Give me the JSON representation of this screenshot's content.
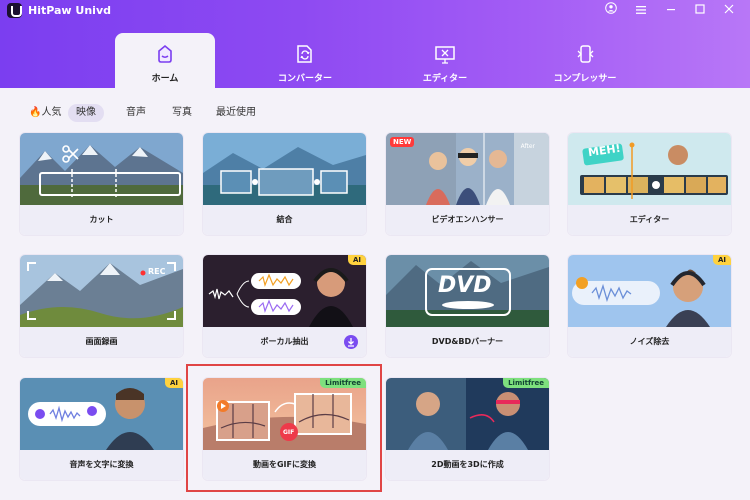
{
  "app": {
    "title": "HitPaw Univd"
  },
  "window_controls": [
    "user-icon",
    "menu-icon",
    "minimize-icon",
    "maximize-icon",
    "close-icon"
  ],
  "nav": {
    "tabs": [
      {
        "label": "ホーム",
        "icon": "home-icon",
        "active": true
      },
      {
        "label": "コンバーター",
        "icon": "converter-icon",
        "active": false
      },
      {
        "label": "エディター",
        "icon": "editor-icon",
        "active": false
      },
      {
        "label": "コンプレッサー",
        "icon": "compressor-icon",
        "active": false
      }
    ]
  },
  "categories": [
    {
      "label": "🔥人気",
      "active": false
    },
    {
      "label": "映像",
      "active": true
    },
    {
      "label": "音声",
      "active": false
    },
    {
      "label": "写真",
      "active": false
    },
    {
      "label": "最近使用",
      "active": false
    }
  ],
  "cards": [
    {
      "label": "カット",
      "badge": ""
    },
    {
      "label": "結合",
      "badge": ""
    },
    {
      "label": "ビデオエンハンサー",
      "badge": "NEW",
      "corner_text": "After"
    },
    {
      "label": "エディター",
      "badge": "",
      "thumb_text": "MEH!"
    },
    {
      "label": "画面録画",
      "badge": "",
      "thumb_text": "REC"
    },
    {
      "label": "ボーカル抽出",
      "badge": "AI"
    },
    {
      "label": "DVD&BDバーナー",
      "badge": "",
      "thumb_text": "DVD"
    },
    {
      "label": "ノイズ除去",
      "badge": "AI"
    },
    {
      "label": "音声を文字に変換",
      "badge": "AI"
    },
    {
      "label": "動画をGIFに変換",
      "badge": "Limitfree",
      "thumb_text": "GIF",
      "selected": true
    },
    {
      "label": "2D動画を3Dに作成",
      "badge": "Limitfree"
    }
  ],
  "colors": {
    "accent": "#7b3ef0",
    "selection": "#e04545",
    "ai_badge": "#ffd23e",
    "limitfree_badge": "#7ee07e"
  }
}
